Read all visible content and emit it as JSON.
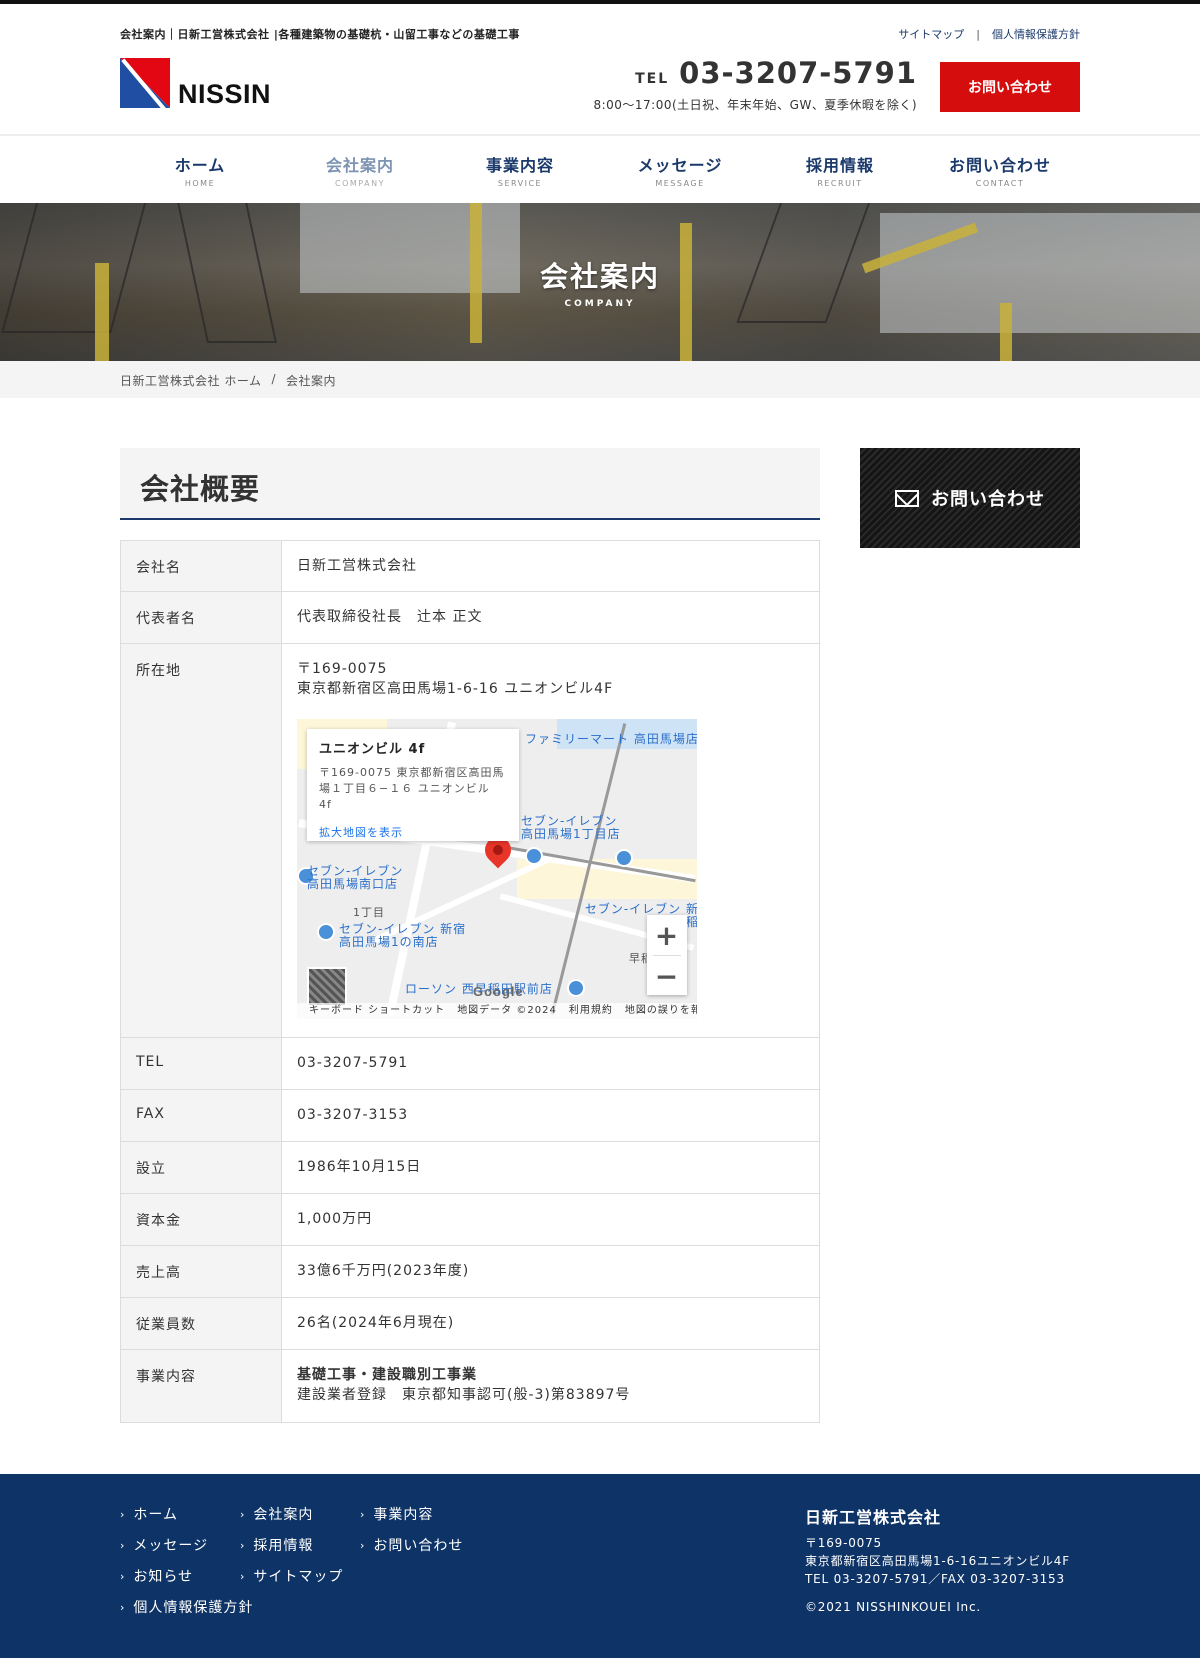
{
  "header": {
    "tagline": "会社案内｜日新工営株式会社 |各種建築物の基礎杭・山留工事などの基礎工事",
    "util_links": [
      "サイトマップ",
      "個人情報保護方針"
    ],
    "logo_text": "NISSIN",
    "tel_label": "TEL",
    "tel_number": "03-3207-5791",
    "hours": "8:00〜17:00(土日祝、年末年始、GW、夏季休暇を除く)",
    "contact_button": "お問い合わせ"
  },
  "nav": [
    {
      "jp": "ホーム",
      "en": "HOME"
    },
    {
      "jp": "会社案内",
      "en": "COMPANY"
    },
    {
      "jp": "事業内容",
      "en": "SERVICE"
    },
    {
      "jp": "メッセージ",
      "en": "MESSAGE"
    },
    {
      "jp": "採用情報",
      "en": "RECRUIT"
    },
    {
      "jp": "お問い合わせ",
      "en": "CONTACT"
    }
  ],
  "hero": {
    "title": "会社案内",
    "subtitle": "COMPANY"
  },
  "breadcrumb": [
    "日新工営株式会社 ホーム",
    "/",
    "会社案内"
  ],
  "section_title": "会社概要",
  "profile": {
    "company_name": {
      "label": "会社名",
      "value": "日新工営株式会社"
    },
    "representative": {
      "label": "代表者名",
      "value": "代表取締役社長　辻本 正文"
    },
    "address": {
      "label": "所在地",
      "postal": "〒169-0075",
      "value": "東京都新宿区高田馬場1-6-16 ユニオンビル4F"
    },
    "tel": {
      "label": "TEL",
      "value": "03-3207-5791"
    },
    "fax": {
      "label": "FAX",
      "value": "03-3207-3153"
    },
    "established": {
      "label": "設立",
      "value": "1986年10月15日"
    },
    "capital": {
      "label": "資本金",
      "value": "1,000万円"
    },
    "sales": {
      "label": "売上高",
      "value": "33億6千万円(2023年度)"
    },
    "employees": {
      "label": "従業員数",
      "value": "26名(2024年6月現在)"
    },
    "business": {
      "label": "事業内容",
      "line1": "基礎工事・建設職別工事業",
      "line2": "建設業者登録　東京都知事認可(般-3)第83897号"
    }
  },
  "map": {
    "info_name": "ユニオンビル 4f",
    "info_addr": "〒169-0075 東京都新宿区高田馬場１丁目６−１６ ユニオンビル 4f",
    "info_link": "拡大地図を表示",
    "labels": {
      "poi1": "ファミリーマート 高田馬場店",
      "poi2": "セブン-イレブン 高田馬場1丁目店",
      "poi3": "セブン-イレブン 高田馬場南口店",
      "poi4": "セブン-イレブン 新宿 高田馬場1の南店",
      "poi5": "セブン-イレブン 新 西早稲",
      "poi6": "ローソン 西早稲田駅前店",
      "area1": "1丁目",
      "area2": "早稲"
    },
    "google": "Google",
    "zoom_in": "+",
    "zoom_out": "−",
    "attribution": [
      "キーボード ショートカット",
      "地図データ ©2024",
      "利用規約",
      "地図の誤りを報告する"
    ]
  },
  "sidebar": {
    "contact": "お問い合わせ"
  },
  "footer": {
    "nav": [
      "ホーム",
      "会社案内",
      "事業内容",
      "メッセージ",
      "採用情報",
      "お問い合わせ",
      "お知らせ",
      "サイトマップ",
      "個人情報保護方針"
    ],
    "company_name": "日新工営株式会社",
    "postal": "〒169-0075",
    "address": "東京都新宿区高田馬場1-6-16ユニオンビル4F",
    "telfax": "TEL 03-3207-5791／FAX 03-3207-3153",
    "copyright": "©2021 NISSHINKOUEI Inc."
  },
  "colors": {
    "brand_navy": "#1b3a6b",
    "footer_bg": "#0e3366",
    "cta_red": "#d50d0d"
  }
}
